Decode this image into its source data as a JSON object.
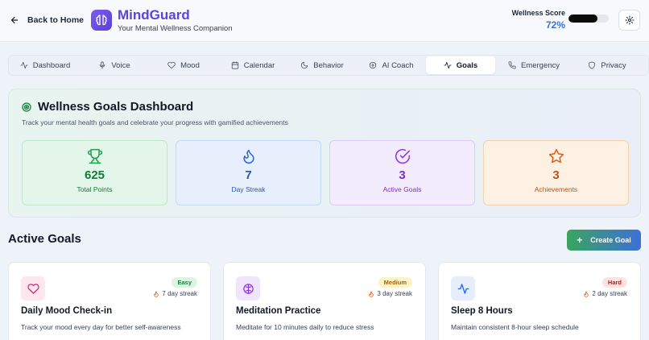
{
  "header": {
    "back_label": "Back to Home",
    "app_title": "MindGuard",
    "app_subtitle": "Your Mental Wellness Companion",
    "wellness_label": "Wellness Score",
    "wellness_value": "72%",
    "wellness_fraction": 0.72,
    "logo_icon": "brain-icon",
    "settings_icon": "gear-icon"
  },
  "tabs": [
    {
      "label": "Dashboard",
      "icon": "activity-icon",
      "active": false
    },
    {
      "label": "Voice",
      "icon": "microphone-icon",
      "active": false
    },
    {
      "label": "Mood",
      "icon": "heart-icon",
      "active": false
    },
    {
      "label": "Calendar",
      "icon": "calendar-icon",
      "active": false
    },
    {
      "label": "Behavior",
      "icon": "moon-icon",
      "active": false
    },
    {
      "label": "AI Coach",
      "icon": "ai-icon",
      "active": false
    },
    {
      "label": "Goals",
      "icon": "activity-icon",
      "active": true
    },
    {
      "label": "Emergency",
      "icon": "phone-icon",
      "active": false
    },
    {
      "label": "Privacy",
      "icon": "shield-icon",
      "active": false
    }
  ],
  "dashboard": {
    "title": "Wellness Goals Dashboard",
    "subtitle": "Track your mental health goals and celebrate your progress with gamified achievements",
    "stats": [
      {
        "value": "625",
        "label": "Total Points",
        "icon": "trophy-icon",
        "color": "#167a3d"
      },
      {
        "value": "7",
        "label": "Day Streak",
        "icon": "flame-icon",
        "color": "#2658b8"
      },
      {
        "value": "3",
        "label": "Active Goals",
        "icon": "check-circle-icon",
        "color": "#7d2fc8"
      },
      {
        "value": "3",
        "label": "Achievements",
        "icon": "star-icon",
        "color": "#c4520f"
      }
    ]
  },
  "active_goals": {
    "title": "Active Goals",
    "create_label": "Create Goal",
    "goals": [
      {
        "title": "Daily Mood Check-in",
        "description": "Track your mood every day for better self-awareness",
        "difficulty": "Easy",
        "streak": "7 day streak",
        "icon": "heart-icon"
      },
      {
        "title": "Meditation Practice",
        "description": "Meditate for 10 minutes daily to reduce stress",
        "difficulty": "Medium",
        "streak": "3 day streak",
        "icon": "brain-icon"
      },
      {
        "title": "Sleep 8 Hours",
        "description": "Maintain consistent 8-hour sleep schedule",
        "difficulty": "Hard",
        "streak": "2 day streak",
        "icon": "activity-icon"
      }
    ]
  },
  "colors": {
    "brand": "#5b45d9",
    "wellness_value": "#3b6fd4",
    "easy_badge": "#16a34a",
    "medium_badge": "#a16207",
    "hard_badge": "#b91c1c"
  }
}
